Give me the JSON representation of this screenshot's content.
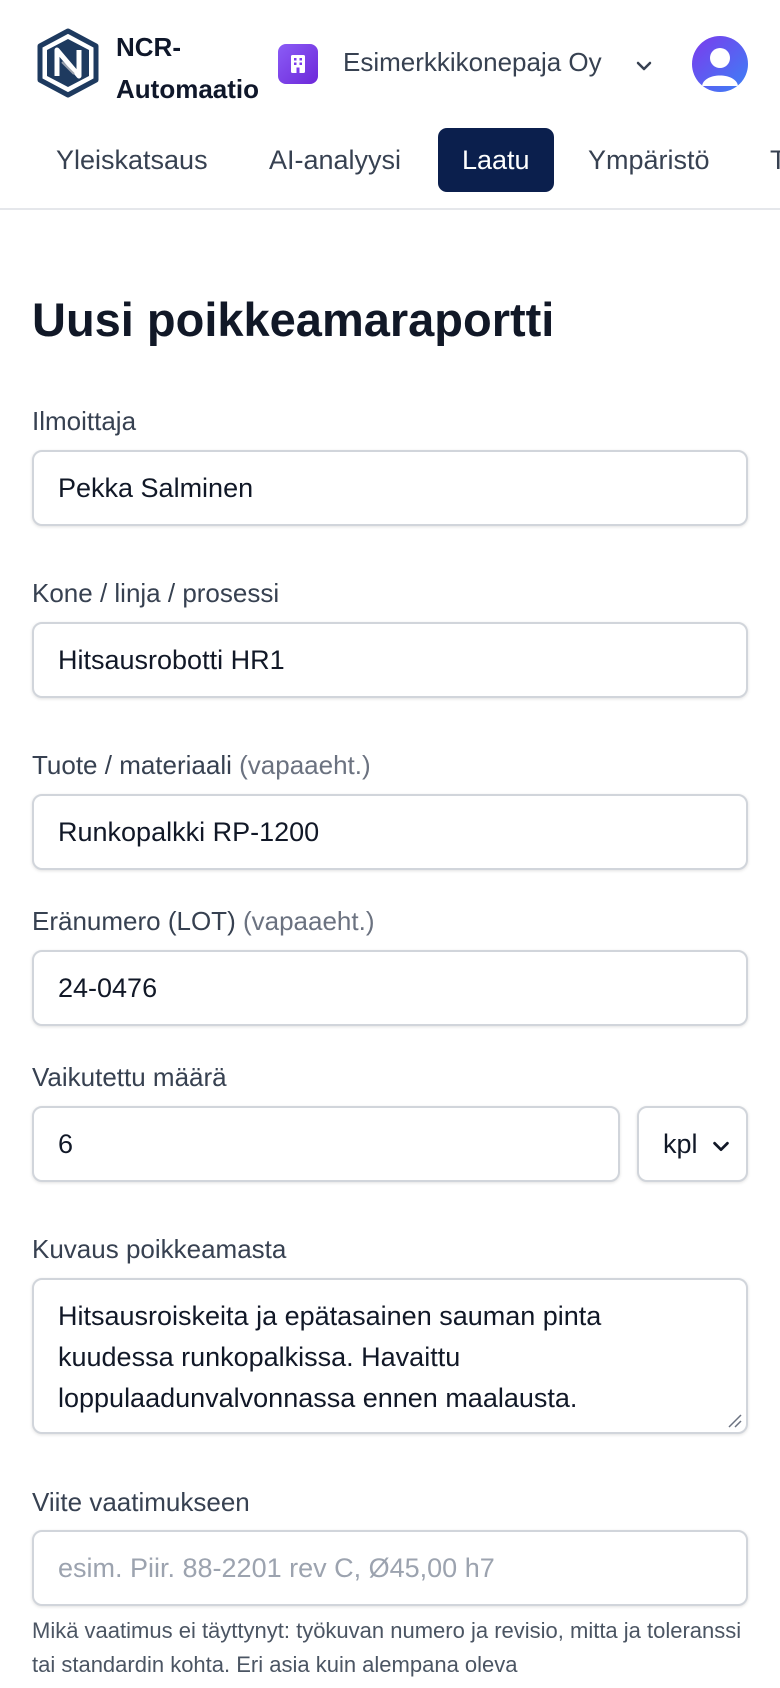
{
  "header": {
    "brand_line1": "NCR-",
    "brand_line2": "Automaatio",
    "logo_icon": "ncr-logo-icon",
    "org_icon": "building-icon",
    "org_name": "Esimerkkikonepaja Oy",
    "avatar_icon": "user-avatar-icon"
  },
  "tabs": [
    {
      "label": "Yleiskatsaus",
      "active": false
    },
    {
      "label": "AI-analyysi",
      "active": false
    },
    {
      "label": "Laatu",
      "active": true
    },
    {
      "label": "Ympäristö",
      "active": false
    },
    {
      "label": "T",
      "active": false
    }
  ],
  "form": {
    "title": "Uusi poikkeamaraportti",
    "reporter": {
      "label": "Ilmoittaja",
      "value": "Pekka Salminen"
    },
    "machine": {
      "label": "Kone / linja / prosessi",
      "value": "Hitsausrobotti HR1"
    },
    "product": {
      "label": "Tuote / materiaali",
      "optional": "(vapaaeht.)",
      "value": "Runkopalkki RP-1200"
    },
    "lot": {
      "label": "Eränumero (LOT)",
      "optional": "(vapaaeht.)",
      "value": "24-0476"
    },
    "quantity": {
      "label": "Vaikutettu määrä",
      "value": "6",
      "unit": "kpl"
    },
    "description": {
      "label": "Kuvaus poikkeamasta",
      "value": "Hitsausroiskeita ja epätasainen sauman pinta kuudessa runkopalkissa. Havaittu loppulaadunvalvonnassa ennen maalausta."
    },
    "requirement": {
      "label": "Viite vaatimukseen",
      "placeholder": "esim. Piir. 88-2201 rev C, Ø45,00 h7",
      "help": "Mikä vaatimus ei täyttynyt: työkuvan numero ja revisio, mitta ja toleranssi tai standardin kohta. Eri asia kuin alempana oleva liitekuva/mittapöytäkirja."
    }
  },
  "colors": {
    "active_tab": "#0b1f4d",
    "org_icon": "#7c3aed",
    "text": "#111827",
    "muted": "#6b7280",
    "border": "#d1d5db"
  }
}
